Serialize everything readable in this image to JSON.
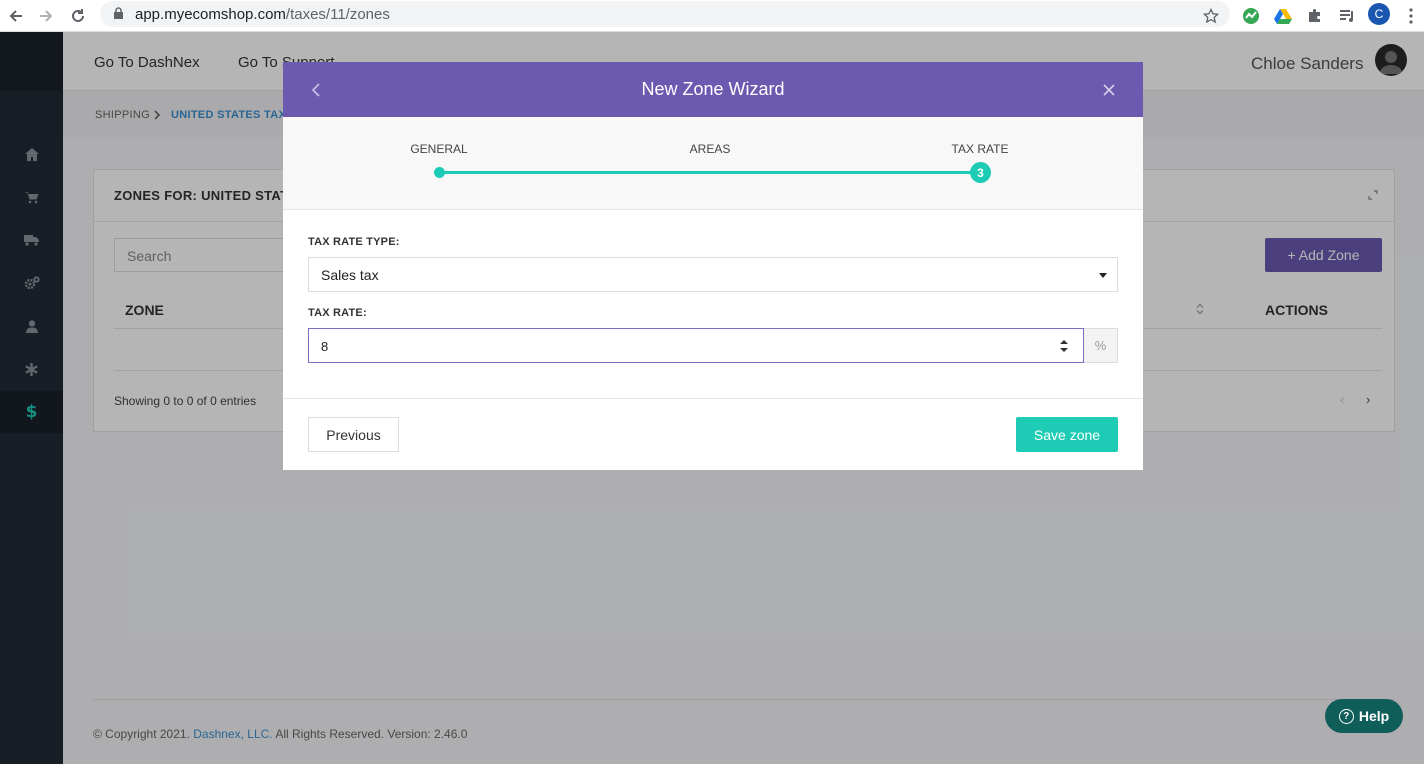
{
  "browser": {
    "url_host": "app.myecomshop.com",
    "url_path": "/taxes/11/zones",
    "profile_initial": "C"
  },
  "topbar": {
    "link_dashnex": "Go To DashNex",
    "link_support": "Go To Support",
    "username": "Chloe Sanders"
  },
  "breadcrumb": {
    "item1": "SHIPPING",
    "item2": "UNITED STATES TAX"
  },
  "card": {
    "title": "ZONES FOR: UNITED STAT",
    "search_placeholder": "Search",
    "add_zone_label": "+ Add Zone",
    "col_zone": "ZONE",
    "col_actions": "ACTIONS",
    "showing": "Showing 0 to 0 of 0 entries"
  },
  "footer": {
    "copyright": "© Copyright 2021.",
    "company": "Dashnex, LLC.",
    "rest": "All Rights Reserved. Version: 2.46.0"
  },
  "modal": {
    "title": "New Zone Wizard",
    "steps": [
      "GENERAL",
      "AREAS",
      "TAX RATE"
    ],
    "current_step_number": "3",
    "tax_rate_type_label": "TAX RATE TYPE:",
    "tax_rate_type_value": "Sales tax",
    "tax_rate_label": "TAX RATE:",
    "tax_rate_value": "8",
    "tax_rate_unit": "%",
    "previous_label": "Previous",
    "save_label": "Save zone"
  },
  "help": {
    "label": "Help"
  },
  "colors": {
    "accent_purple": "#6c5ab0",
    "accent_teal": "#1ecbb5",
    "sidebar": "#222b35",
    "help": "#0f5e5a"
  }
}
